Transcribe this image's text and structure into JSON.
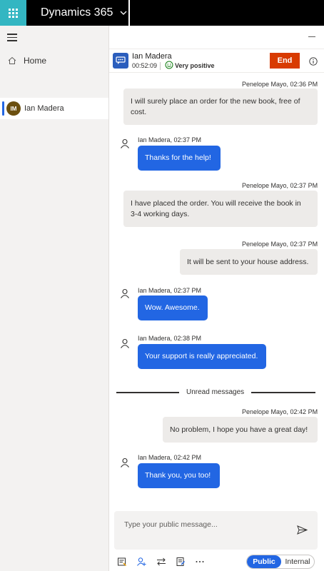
{
  "app": {
    "title": "Dynamics 365"
  },
  "nav": {
    "home_label": "Home",
    "session": {
      "initials": "IM",
      "name": "Ian Madera"
    }
  },
  "conversation": {
    "customer_name": "Ian Madera",
    "timer": "00:52:09",
    "sentiment": "Very positive",
    "end_label": "End"
  },
  "messages": [
    {
      "direction": "in",
      "meta": "Penelope Mayo, 02:36 PM",
      "text_lines": [
        "I will surely place an order for the new book, free of",
        "cost."
      ]
    },
    {
      "direction": "out",
      "meta": "Ian Madera, 02:37 PM",
      "text_lines": [
        "Thanks for the help!"
      ]
    },
    {
      "direction": "in",
      "meta": "Penelope Mayo, 02:37 PM",
      "text_lines": [
        "I have placed the order. You will receive the book in",
        "3-4 working days."
      ]
    },
    {
      "direction": "in",
      "meta": "Penelope Mayo, 02:37 PM",
      "text_lines": [
        "It will be sent to your house address."
      ]
    },
    {
      "direction": "out",
      "meta": "Ian Madera, 02:37 PM",
      "text_lines": [
        "Wow. Awesome."
      ]
    },
    {
      "direction": "out",
      "meta": "Ian Madera, 02:38 PM",
      "text_lines": [
        "Your support is really appreciated."
      ]
    },
    {
      "direction": "in",
      "meta": "Penelope Mayo, 02:42 PM",
      "text_lines": [
        "No problem, I hope you have a great day!"
      ]
    },
    {
      "direction": "out",
      "meta": "Ian Madera, 02:42 PM",
      "text_lines": [
        "Thank you, you too!"
      ]
    }
  ],
  "unread_label": "Unread messages",
  "composer": {
    "placeholder": "Type your public message..."
  },
  "toggle": {
    "public_label": "Public",
    "internal_label": "Internal",
    "selected": "Public"
  },
  "colors": {
    "accent": "#2266e3",
    "end_button": "#d83b01",
    "waffle": "#33b6c2"
  }
}
